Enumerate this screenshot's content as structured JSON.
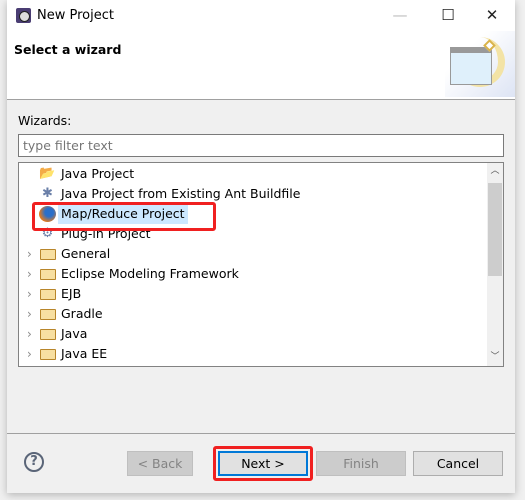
{
  "window": {
    "title": "New Project"
  },
  "header": {
    "title": "Select a wizard"
  },
  "wizards": {
    "label": "Wizards:",
    "filter_placeholder": "type filter text",
    "items": [
      {
        "label": "Java Project",
        "type": "item",
        "icon": "java-project-icon"
      },
      {
        "label": "Java Project from Existing Ant Buildfile",
        "type": "item",
        "icon": "ant-icon"
      },
      {
        "label": "Map/Reduce Project",
        "type": "item",
        "icon": "mapreduce-icon",
        "selected": true
      },
      {
        "label": "Plug-in Project",
        "type": "item",
        "icon": "plugin-icon"
      },
      {
        "label": "General",
        "type": "folder"
      },
      {
        "label": "Eclipse Modeling Framework",
        "type": "folder"
      },
      {
        "label": "EJB",
        "type": "folder"
      },
      {
        "label": "Gradle",
        "type": "folder"
      },
      {
        "label": "Java",
        "type": "folder"
      },
      {
        "label": "Java EE",
        "type": "folder"
      }
    ]
  },
  "buttons": {
    "back": "< Back",
    "next": "Next >",
    "finish": "Finish",
    "cancel": "Cancel",
    "help": "?"
  },
  "colors": {
    "highlight_annotation": "#f02020",
    "selection": "#cce8ff",
    "default_button_border": "#0078d7"
  }
}
